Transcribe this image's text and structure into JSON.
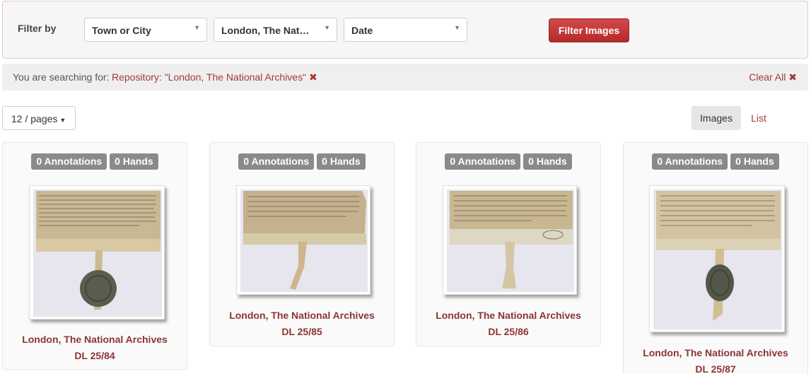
{
  "filter": {
    "label": "Filter by",
    "selects": [
      {
        "value": "Town or City"
      },
      {
        "value": "London, The Nat…"
      },
      {
        "value": "Date"
      }
    ],
    "button_label": "Filter Images"
  },
  "search": {
    "prefix": "You are searching for:",
    "term": "Repository: \"London, The National Archives\"",
    "remove_icon": "✖",
    "clear_label": "Clear All",
    "clear_icon": "✖"
  },
  "pagination": {
    "per_page_label": "12 / pages"
  },
  "view": {
    "images_label": "Images",
    "list_label": "List"
  },
  "cards": [
    {
      "annotations": "0 Annotations",
      "hands": "0 Hands",
      "repository": "London, The National Archives",
      "shelfmark": "DL 25/84"
    },
    {
      "annotations": "0 Annotations",
      "hands": "0 Hands",
      "repository": "London, The National Archives",
      "shelfmark": "DL 25/85"
    },
    {
      "annotations": "0 Annotations",
      "hands": "0 Hands",
      "repository": "London, The National Archives",
      "shelfmark": "DL 25/86"
    },
    {
      "annotations": "0 Annotations",
      "hands": "0 Hands",
      "repository": "London, The National Archives",
      "shelfmark": "DL 25/87"
    }
  ],
  "colors": {
    "accent": "#a03a3a",
    "button": "#c03636",
    "badge": "#8a8a8a"
  }
}
